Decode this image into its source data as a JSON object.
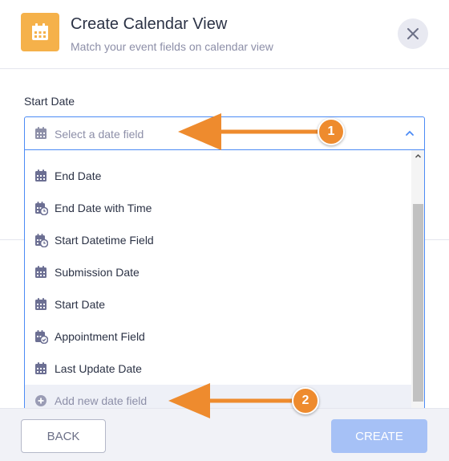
{
  "dialog": {
    "title": "Create Calendar View",
    "subtitle": "Match your event fields on calendar view",
    "close_icon": "close-icon"
  },
  "field": {
    "label": "Start Date",
    "placeholder": "Select a date field"
  },
  "options": [
    {
      "label": "End Date",
      "icon": "calendar-icon"
    },
    {
      "label": "End Date with Time",
      "icon": "calendar-clock-icon"
    },
    {
      "label": "Start Datetime Field",
      "icon": "calendar-clock-icon"
    },
    {
      "label": "Submission Date",
      "icon": "calendar-icon"
    },
    {
      "label": "Start Date",
      "icon": "calendar-icon"
    },
    {
      "label": "Appointment Field",
      "icon": "calendar-check-icon"
    },
    {
      "label": "Last Update Date",
      "icon": "calendar-icon"
    },
    {
      "label": "Add new date field",
      "icon": "plus-circle-icon"
    }
  ],
  "footer": {
    "back_label": "BACK",
    "create_label": "CREATE"
  },
  "annotations": [
    "1",
    "2"
  ],
  "colors": {
    "accent": "#4c8bf5",
    "header_icon_bg": "#f5b14a",
    "annotation": "#ee8b2e",
    "create_button": "#a6c1f6"
  }
}
